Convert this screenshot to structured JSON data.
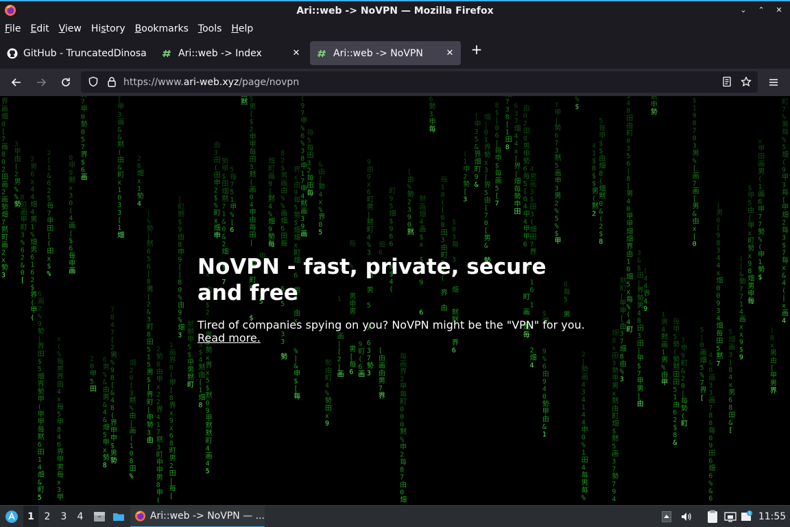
{
  "window": {
    "title": "Ari::web -> NoVPN — Mozilla Firefox",
    "controls": [
      "⌄",
      "⌃",
      "✕"
    ]
  },
  "menubar": [
    "File",
    "Edit",
    "View",
    "History",
    "Bookmarks",
    "Tools",
    "Help"
  ],
  "tabs": [
    {
      "label": "GitHub - TruncatedDinosa",
      "icon": "github-icon",
      "selected": false
    },
    {
      "label": "Ari::web -> Index",
      "icon": "ari-web-icon",
      "selected": false
    },
    {
      "label": "Ari::web -> NoVPN",
      "icon": "ari-web-icon",
      "selected": true
    }
  ],
  "tab_close": "✕",
  "new_tab": "+",
  "navbar": {
    "url_prefix": "https://www.",
    "url_host": "ari-web.xyz",
    "url_path": "/page/novpn"
  },
  "page": {
    "heading": "NoVPN - fast, private, secure and free",
    "tagline": "Tired of companies spying on you? NoVPN might be the \"VPN\" for you.",
    "read_more": "Read more.",
    "colors": {
      "rain": "#1fbf1f",
      "rain_bright": "#5cff5c",
      "background": "#000000"
    }
  },
  "taskbar": {
    "desktops": [
      "1",
      "2",
      "3",
      "4"
    ],
    "active_desktop": "1",
    "task_label": "Ari::web -> NoVPN — ...",
    "clock": "11:55"
  }
}
